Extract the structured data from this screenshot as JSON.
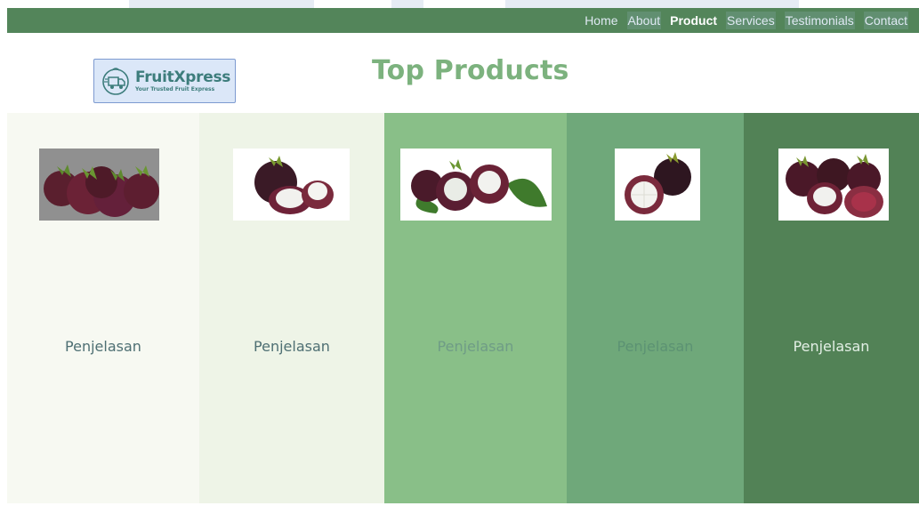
{
  "nav": {
    "items": [
      {
        "label": "Home"
      },
      {
        "label": "About"
      },
      {
        "label": "Product"
      },
      {
        "label": "Services"
      },
      {
        "label": "Testimonials"
      },
      {
        "label": "Contact"
      }
    ],
    "active_item": "Product",
    "background_color": "#53855a"
  },
  "logo": {
    "name": "FruitXpress",
    "tagline": "Your Trusted Fruit Express",
    "icon": "delivery-truck-icon"
  },
  "page": {
    "title": "Top Products"
  },
  "products": [
    {
      "label": "Penjelasan",
      "image": "mangosteen-bunch-photo",
      "background": "#f7f9f2",
      "text_color": "#4e6f73"
    },
    {
      "label": "Penjelasan",
      "image": "mangosteen-opened-photo",
      "background": "#eef4e7",
      "text_color": "#4e6f73"
    },
    {
      "label": "Penjelasan",
      "image": "mangosteen-leaves-photo",
      "background": "#89bf88",
      "text_color": "#6f9c86"
    },
    {
      "label": "Penjelasan",
      "image": "mangosteen-half-photo",
      "background": "#6fa87a",
      "text_color": "#5c9273"
    },
    {
      "label": "Penjelasan",
      "image": "mangosteen-group-photo",
      "background": "#528256",
      "text_color": "#e3efe5"
    }
  ]
}
